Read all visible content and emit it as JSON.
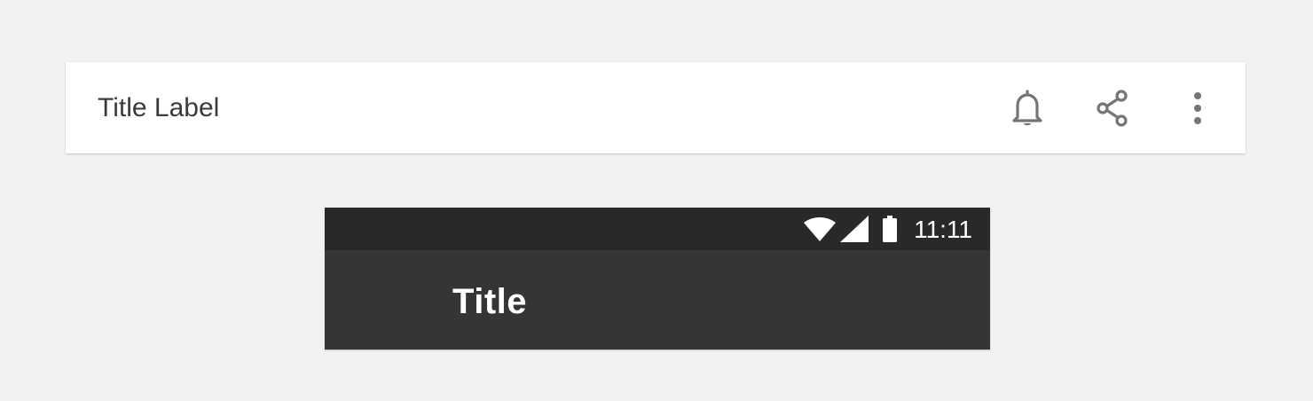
{
  "toolbar": {
    "title": "Title Label",
    "actions": [
      {
        "icon": "bell-icon",
        "label": "Notifications"
      },
      {
        "icon": "share-icon",
        "label": "Share"
      },
      {
        "icon": "more-vert-icon",
        "label": "More options"
      }
    ],
    "icon_color": "#757575",
    "background": "#ffffff"
  },
  "phone": {
    "status_bar": {
      "time": "11:11",
      "icons": [
        "wifi-icon",
        "cellular-signal-icon",
        "battery-icon"
      ],
      "background": "#292929"
    },
    "app_bar": {
      "title": "Title",
      "background": "#353535"
    }
  },
  "page_background": "#f2f2f2"
}
